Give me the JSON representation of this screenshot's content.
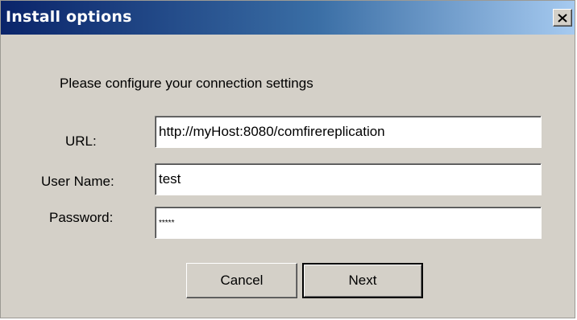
{
  "dialog": {
    "title": "Install options",
    "close_icon": "close-icon",
    "prompt": "Please configure your connection settings"
  },
  "form": {
    "url": {
      "label": "URL:",
      "value": "http://myHost:8080/comfirereplication"
    },
    "username": {
      "label": "User Name:",
      "value": "test"
    },
    "password": {
      "label": "Password:",
      "value": "*****"
    }
  },
  "buttons": {
    "cancel": "Cancel",
    "next": "Next"
  }
}
